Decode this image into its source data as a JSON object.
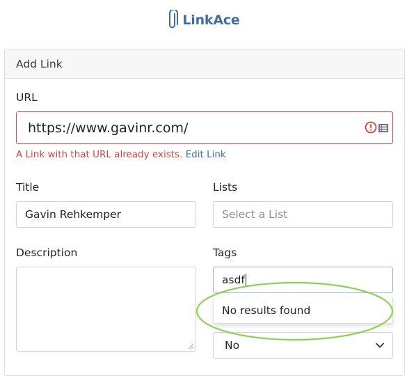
{
  "brand": {
    "name": "LinkAce"
  },
  "card": {
    "title": "Add Link"
  },
  "form": {
    "url": {
      "label": "URL",
      "value": "https://www.gavinr.com/",
      "error_text": "A Link with that URL already exists.",
      "error_link": "Edit Link"
    },
    "title": {
      "label": "Title",
      "value": "Gavin Rehkemper"
    },
    "lists": {
      "label": "Lists",
      "placeholder": "Select a List"
    },
    "description": {
      "label": "Description",
      "value": ""
    },
    "tags": {
      "label": "Tags",
      "value": "asdf",
      "dropdown_message": "No results found"
    },
    "private": {
      "selected": "No"
    }
  },
  "colors": {
    "brand": "#3e6fa0",
    "error": "#d0443e",
    "annotation": "#8fd14f"
  },
  "icons": {
    "brand": "paperclip-icon",
    "url_alert": "alert-circle-icon",
    "url_list": "list-icon",
    "select_arrow": "chevron-down-icon"
  }
}
